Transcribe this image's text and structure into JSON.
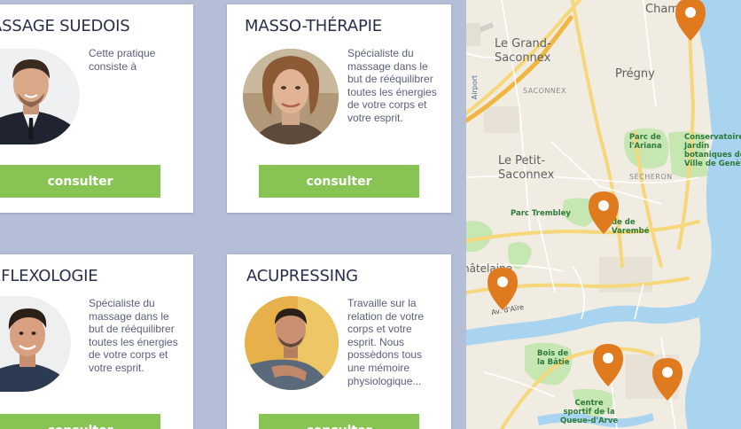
{
  "cards": [
    {
      "title": "ASSAGE SUEDOIS",
      "description": "Cette pratique consiste à",
      "button_label": "consulter"
    },
    {
      "title": "MASSO-THÉRAPIE",
      "description": "Spécialiste du massage dans le but de rééquilibrer toutes les énergies de votre corps et votre esprit.",
      "button_label": "consulter"
    },
    {
      "title": "ÉFLEXOLOGIE",
      "description": "Spécialiste du massage dans le but de rééquilibrer toutes les énergies de votre corps et votre esprit.",
      "button_label": "consulter"
    },
    {
      "title": "ACUPRESSING",
      "description": "Travaille sur la relation de votre corps et votre esprit. Nous possèdons tous une mémoire physiologique...",
      "button_label": "consulter"
    }
  ],
  "map": {
    "labels": {
      "le_grand_saconnex": "Le Grand-\nSaconnex",
      "saconnex": "SACONNEX",
      "pregny": "Prégny",
      "le_petit_saconnex": "Le Petit-\nSaconnex",
      "secheron": "SÉCHERON",
      "parc_ariana": "Parc de\nl'Ariana",
      "conservatoire": "Conservatoire\nJardin\nbotaniques de la\nVille de Genève",
      "parc_trembley": "Parc Trembley",
      "de_varembe": "de de\nVarembé",
      "chatelaine": "hâtelaine",
      "av_aire": "Av. d'Aïre",
      "bois_batie": "Bois de\nla Bâtie",
      "centre_sportif": "Centre\nsportif de la\nQueue-d'Arve",
      "chambesy": "Cham",
      "airport": "Airport"
    },
    "pin_color": "#e07a1f",
    "pin_count": 5
  }
}
